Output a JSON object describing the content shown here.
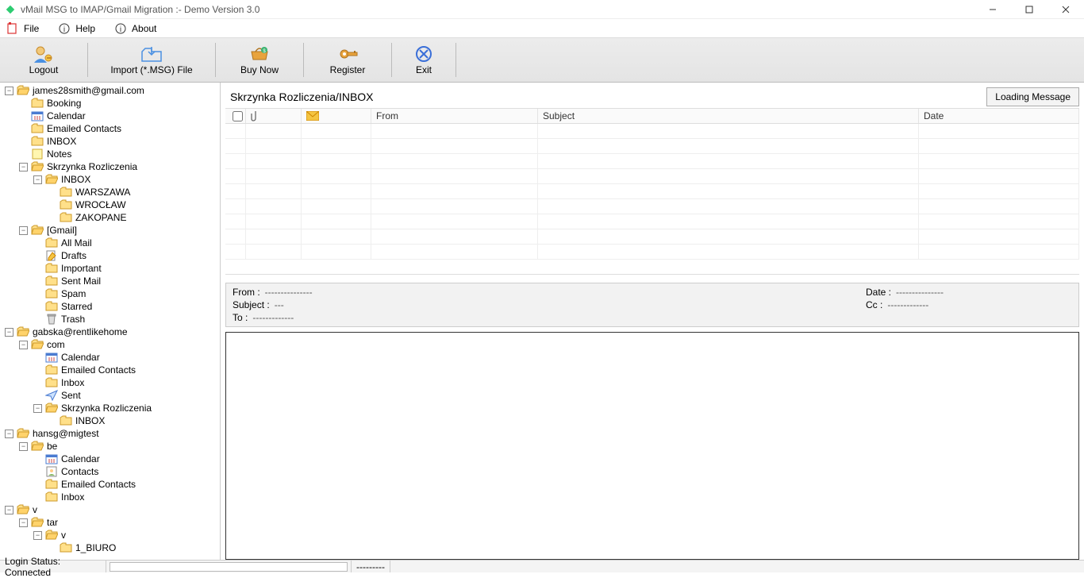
{
  "titlebar": {
    "title": "vMail MSG to IMAP/Gmail Migration :- Demo Version 3.0"
  },
  "menubar": {
    "file": "File",
    "help": "Help",
    "about": "About"
  },
  "toolbar": {
    "logout": "Logout",
    "import": "Import (*.MSG) File",
    "buynow": "Buy Now",
    "register": "Register",
    "exit": "Exit"
  },
  "tree": [
    {
      "d": 0,
      "exp": "-",
      "ic": "folder-open",
      "lbl": "james28smith@gmail.com"
    },
    {
      "d": 1,
      "exp": "",
      "ic": "folder",
      "lbl": "Booking"
    },
    {
      "d": 1,
      "exp": "",
      "ic": "calendar",
      "lbl": "Calendar"
    },
    {
      "d": 1,
      "exp": "",
      "ic": "folder",
      "lbl": "Emailed Contacts"
    },
    {
      "d": 1,
      "exp": "",
      "ic": "folder",
      "lbl": "INBOX"
    },
    {
      "d": 1,
      "exp": "",
      "ic": "note",
      "lbl": "Notes"
    },
    {
      "d": 1,
      "exp": "-",
      "ic": "folder-open",
      "lbl": "Skrzynka Rozliczenia"
    },
    {
      "d": 2,
      "exp": "-",
      "ic": "folder-open",
      "lbl": "INBOX"
    },
    {
      "d": 3,
      "exp": "",
      "ic": "folder",
      "lbl": "WARSZAWA"
    },
    {
      "d": 3,
      "exp": "",
      "ic": "folder",
      "lbl": "WROCŁAW"
    },
    {
      "d": 3,
      "exp": "",
      "ic": "folder",
      "lbl": "ZAKOPANE"
    },
    {
      "d": 1,
      "exp": "-",
      "ic": "folder-open",
      "lbl": "[Gmail]"
    },
    {
      "d": 2,
      "exp": "",
      "ic": "folder",
      "lbl": "All Mail"
    },
    {
      "d": 2,
      "exp": "",
      "ic": "drafts",
      "lbl": "Drafts"
    },
    {
      "d": 2,
      "exp": "",
      "ic": "folder",
      "lbl": "Important"
    },
    {
      "d": 2,
      "exp": "",
      "ic": "folder",
      "lbl": "Sent Mail"
    },
    {
      "d": 2,
      "exp": "",
      "ic": "folder",
      "lbl": "Spam"
    },
    {
      "d": 2,
      "exp": "",
      "ic": "folder",
      "lbl": "Starred"
    },
    {
      "d": 2,
      "exp": "",
      "ic": "trash",
      "lbl": "Trash"
    },
    {
      "d": 0,
      "exp": "-",
      "ic": "folder-open",
      "lbl": "gabska@rentlikehome"
    },
    {
      "d": 1,
      "exp": "-",
      "ic": "folder-open",
      "lbl": "com"
    },
    {
      "d": 2,
      "exp": "",
      "ic": "calendar",
      "lbl": "Calendar"
    },
    {
      "d": 2,
      "exp": "",
      "ic": "folder",
      "lbl": "Emailed Contacts"
    },
    {
      "d": 2,
      "exp": "",
      "ic": "folder",
      "lbl": "Inbox"
    },
    {
      "d": 2,
      "exp": "",
      "ic": "sent",
      "lbl": "Sent"
    },
    {
      "d": 2,
      "exp": "-",
      "ic": "folder-open",
      "lbl": "Skrzynka Rozliczenia"
    },
    {
      "d": 3,
      "exp": "",
      "ic": "folder",
      "lbl": "INBOX"
    },
    {
      "d": 0,
      "exp": "-",
      "ic": "folder-open",
      "lbl": "hansg@migtest"
    },
    {
      "d": 1,
      "exp": "-",
      "ic": "folder-open",
      "lbl": "be"
    },
    {
      "d": 2,
      "exp": "",
      "ic": "calendar",
      "lbl": "Calendar"
    },
    {
      "d": 2,
      "exp": "",
      "ic": "contacts",
      "lbl": "Contacts"
    },
    {
      "d": 2,
      "exp": "",
      "ic": "folder",
      "lbl": "Emailed Contacts"
    },
    {
      "d": 2,
      "exp": "",
      "ic": "folder",
      "lbl": "Inbox"
    },
    {
      "d": 0,
      "exp": "-",
      "ic": "folder-open",
      "lbl": "v"
    },
    {
      "d": 1,
      "exp": "-",
      "ic": "folder-open",
      "lbl": "tar"
    },
    {
      "d": 2,
      "exp": "-",
      "ic": "folder-open",
      "lbl": "v"
    },
    {
      "d": 3,
      "exp": "",
      "ic": "folder",
      "lbl": "1_BIURO"
    }
  ],
  "detail": {
    "breadcrumb": "Skrzynka Rozliczenia/INBOX",
    "loading": "Loading Message",
    "cols": {
      "from": "From",
      "subject": "Subject",
      "date": "Date"
    }
  },
  "preview": {
    "from_label": "From :",
    "from_val": "---------------",
    "subject_label": "Subject :",
    "subject_val": "---",
    "to_label": "To :",
    "to_val": "-------------",
    "date_label": "Date :",
    "date_val": "---------------",
    "cc_label": "Cc :",
    "cc_val": "-------------"
  },
  "status": {
    "login": "Login Status: Connected",
    "extra": "---------"
  }
}
